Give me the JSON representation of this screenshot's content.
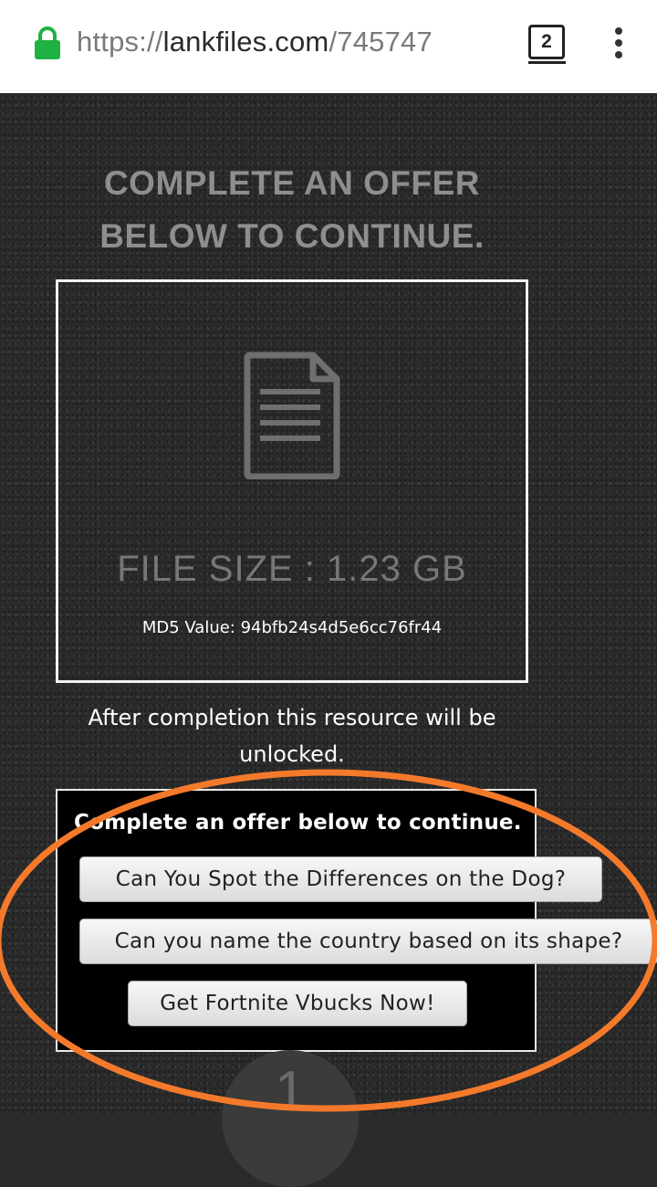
{
  "browser": {
    "url_scheme": "https://",
    "url_host": "lankfiles.com",
    "url_path": "/745747",
    "tab_count": "2",
    "icons": [
      "lock-icon",
      "tab-switcher-icon",
      "overflow-menu-icon"
    ],
    "lock_color": "#1fb141"
  },
  "page": {
    "headline_line1": "COMPLETE AN OFFER",
    "headline_line2": "BELOW TO CONTINUE.",
    "file": {
      "icon": "document-icon",
      "size_text": "FILE SIZE : 1.23 GB",
      "md5_text": "MD5 Value: 94bfb24s4d5e6cc76fr44"
    },
    "after_completion": "After completion this resource will be unlocked.",
    "offers": {
      "title": "Complete an offer below to continue.",
      "items": [
        "Can You Spot the Differences on the Dog?",
        "Can you name the country based on its shape?",
        "Get Fortnite Vbucks Now!"
      ]
    },
    "pager_number": "1"
  },
  "colors": {
    "background": "#2a2a2a",
    "headline": "#8e8e8e",
    "annotation_outline": "#f47a2b"
  }
}
